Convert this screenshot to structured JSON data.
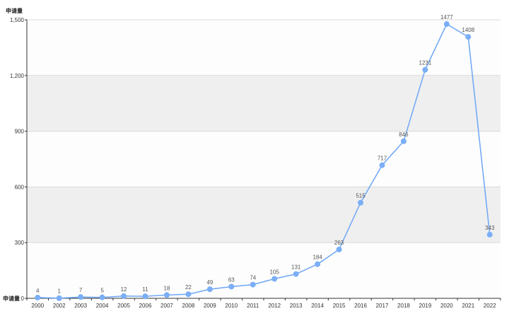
{
  "chart_data": {
    "type": "line",
    "ylabel": "申请量",
    "xlabel": "",
    "categories": [
      "2000",
      "2002",
      "2003",
      "2004",
      "2005",
      "2006",
      "2007",
      "2008",
      "2009",
      "2010",
      "2011",
      "2012",
      "2013",
      "2014",
      "2015",
      "2016",
      "2017",
      "2018",
      "2019",
      "2020",
      "2021",
      "2022"
    ],
    "series": [
      {
        "values": [
          4,
          1,
          7,
          5,
          12,
          11,
          18,
          22,
          49,
          63,
          74,
          105,
          131,
          184,
          263,
          515,
          717,
          846,
          1231,
          1477,
          1408,
          343
        ]
      }
    ],
    "data_labels": [
      "4",
      "1",
      "7",
      "5",
      "12",
      "11",
      "18",
      "22",
      "49",
      "63",
      "74",
      "105",
      "131",
      "184",
      "263",
      "515",
      "717",
      "846",
      "1231",
      "1477",
      "1408",
      "343"
    ],
    "ylim": [
      0,
      1500
    ],
    "yticks": [
      0,
      300,
      600,
      900,
      1200,
      1500
    ],
    "ytick_labels": [
      "0",
      "300",
      "600",
      "900",
      "1,200",
      "1,500"
    ],
    "grid": true,
    "colors": {
      "line": "#6ea6f5",
      "marker": "#7aaef7",
      "band": "#efefef"
    }
  }
}
